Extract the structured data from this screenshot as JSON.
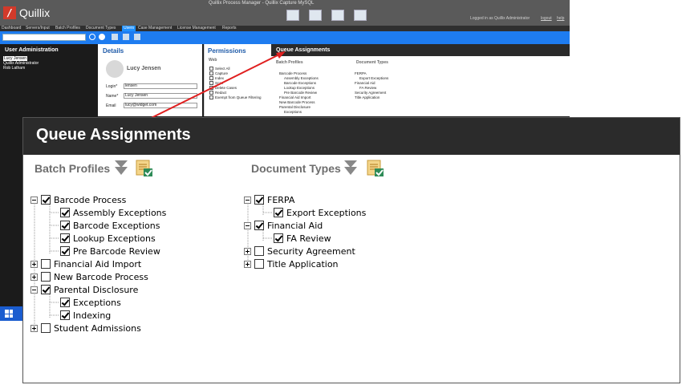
{
  "app": {
    "name": "Quillix",
    "window_title": "Quillix Process Manager - Quillix Capture MySQL",
    "logged_in_text": "Logged in as Quillix Administrator",
    "logout_label": "logout",
    "help_label": "help"
  },
  "menu": {
    "items": [
      "Dashboard",
      "Servers/Input",
      "Batch Profiles",
      "Document Types",
      "Users",
      "Case Management",
      "License Management",
      "Reports"
    ],
    "active": "Users"
  },
  "user_admin": {
    "title": "User Administration",
    "users": [
      "Lucy Jensen",
      "Quillix Administrator",
      "Rob Latham"
    ]
  },
  "details": {
    "title": "Details",
    "name": "Lucy Jensen",
    "login_label": "Login*",
    "login_value": "lensen",
    "name_label": "Name*",
    "name_value": "Lucy Jensen",
    "email_label": "Email",
    "email_value": "lucy@widget.com"
  },
  "permissions": {
    "title": "Permissions",
    "group": "Web",
    "items": [
      "Select All",
      "Capture",
      "Index",
      "Scan",
      "Delete Cases",
      "Redact",
      "Exempt from Queue Filtering"
    ]
  },
  "queue": {
    "title": "Queue Assignments",
    "batch_label": "Batch Profiles",
    "doc_label": "Document Types",
    "batch_tree": [
      {
        "label": "Barcode Process",
        "checked": true,
        "expander": "minus",
        "level": 0
      },
      {
        "label": "Assembly Exceptions",
        "checked": true,
        "level": 1
      },
      {
        "label": "Barcode Exceptions",
        "checked": true,
        "level": 1
      },
      {
        "label": "Lookup Exceptions",
        "checked": true,
        "level": 1
      },
      {
        "label": "Pre Barcode Review",
        "checked": true,
        "level": 1
      },
      {
        "label": "Financial Aid Import",
        "checked": false,
        "expander": "plus",
        "level": 0
      },
      {
        "label": "New Barcode Process",
        "checked": false,
        "expander": "plus",
        "level": 0
      },
      {
        "label": "Parental Disclosure",
        "checked": true,
        "expander": "minus",
        "level": 0
      },
      {
        "label": "Exceptions",
        "checked": true,
        "level": 1
      },
      {
        "label": "Indexing",
        "checked": true,
        "level": 1
      },
      {
        "label": "Student Admissions",
        "checked": false,
        "expander": "plus",
        "level": 0
      }
    ],
    "doc_tree": [
      {
        "label": "FERPA",
        "checked": true,
        "expander": "minus",
        "level": 0
      },
      {
        "label": "Export Exceptions",
        "checked": true,
        "level": 1
      },
      {
        "label": "Financial Aid",
        "checked": true,
        "expander": "minus",
        "level": 0
      },
      {
        "label": "FA Review",
        "checked": true,
        "level": 1
      },
      {
        "label": "Security Agreement",
        "checked": false,
        "expander": "plus",
        "level": 0
      },
      {
        "label": "Title Application",
        "checked": false,
        "expander": "plus",
        "level": 0
      }
    ]
  },
  "colors": {
    "accent_blue": "#1e7cf0",
    "header_dark": "#2b2b2b",
    "logo_red": "#d23a2a",
    "callout_red": "#e02020"
  }
}
